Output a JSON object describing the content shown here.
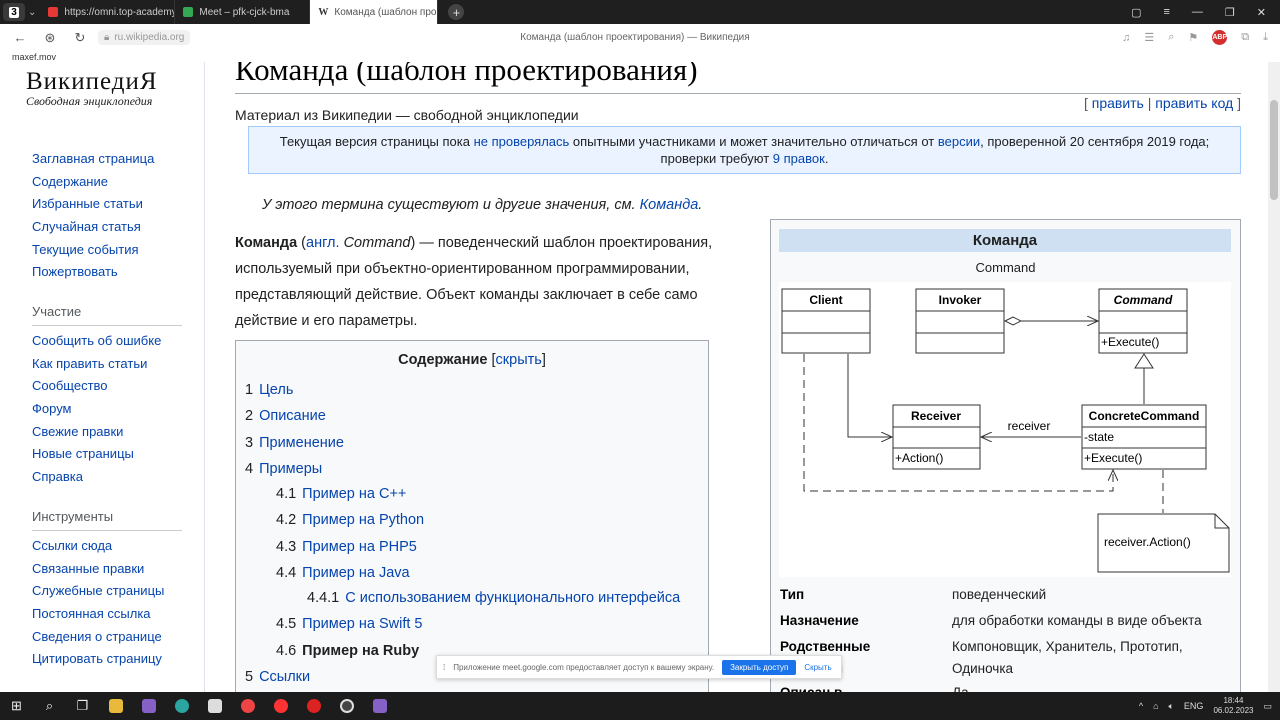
{
  "browser": {
    "tab_count": "3",
    "tabs": [
      {
        "title": "https://omni.top-academy",
        "color": "#e53935",
        "active": false
      },
      {
        "title": "Meet – pfk-cjck-bma",
        "color": "#34a853",
        "active": false
      },
      {
        "title": "Команда (шаблон про",
        "icon": "W",
        "active": true
      }
    ],
    "url": "ru.wikipedia.org",
    "page_title": "Команда (шаблон проектирования) — Википедия",
    "sublabel": "maxef.mov"
  },
  "sidebar": {
    "logo_title": "ВикипедиЯ",
    "logo_tagline": "Свободная энциклопедия",
    "main_nav": [
      "Заглавная страница",
      "Содержание",
      "Избранные статьи",
      "Случайная статья",
      "Текущие события",
      "Пожертвовать"
    ],
    "participation_head": "Участие",
    "participation": [
      "Сообщить об ошибке",
      "Как править статьи",
      "Сообщество",
      "Форум",
      "Свежие правки",
      "Новые страницы",
      "Справка"
    ],
    "tools_head": "Инструменты",
    "tools": [
      "Ссылки сюда",
      "Связанные правки",
      "Служебные страницы",
      "Постоянная ссылка",
      "Сведения о странице",
      "Цитировать страницу"
    ]
  },
  "article": {
    "title": "Команда (шаблон проектирования)",
    "edit": "править",
    "edit_code": "править код",
    "from": "Материал из Википедии — свободной энциклопедии",
    "notice_1": "Текущая версия страницы пока ",
    "notice_link1": "не проверялась",
    "notice_2": " опытными участниками и может значительно отличаться от ",
    "notice_link2": "версии",
    "notice_3": ", проверенной 20 сентября 2019 года; проверки требуют ",
    "notice_link3": "9 правок",
    "notice_4": ".",
    "hatnote_text": "У этого термина существуют и другие значения, см. ",
    "hatnote_link": "Команда",
    "lead_term": "Команда",
    "lead_lang": "англ.",
    "lead_en": "Command",
    "lead_rest": ") — поведенческий шаблон проектирования, используемый при объектно-ориентированном программировании, представляющий действие. Объект команды заключает в себе само действие и его параметры."
  },
  "toc": {
    "title": "Содержание",
    "hide": "скрыть",
    "items": [
      {
        "num": "1",
        "label": "Цель"
      },
      {
        "num": "2",
        "label": "Описание"
      },
      {
        "num": "3",
        "label": "Применение"
      },
      {
        "num": "4",
        "label": "Примеры"
      },
      {
        "num": "4.1",
        "label": "Пример на C++"
      },
      {
        "num": "4.2",
        "label": "Пример на Python"
      },
      {
        "num": "4.3",
        "label": "Пример на PHP5"
      },
      {
        "num": "4.4",
        "label": "Пример на Java"
      },
      {
        "num": "4.4.1",
        "label": "С использованием функционального интерфейса"
      },
      {
        "num": "4.5",
        "label": "Пример на Swift 5"
      },
      {
        "num": "4.6",
        "label": "Пример на Ruby"
      },
      {
        "num": "5",
        "label": "Ссылки"
      }
    ]
  },
  "infobox": {
    "title": "Команда",
    "subtitle": "Command",
    "uml": {
      "client": "Client",
      "invoker": "Invoker",
      "command": "Command",
      "command_op": "+Execute()",
      "receiver": "Receiver",
      "receiver_op": "+Action()",
      "concrete": "ConcreteCommand",
      "concrete_attr": "-state",
      "concrete_op": "+Execute()",
      "assoc": "receiver",
      "note": "receiver.Action()"
    },
    "rows": [
      {
        "key": "Тип",
        "value": "поведенческий"
      },
      {
        "key": "Назначение",
        "value": "для обработки команды в виде объекта"
      },
      {
        "key": "Родственные шаблоны",
        "value": "Компоновщик, Хранитель, Прототип, Одиночка"
      },
      {
        "key": "Описан в",
        "value": "Да"
      }
    ]
  },
  "share": {
    "text": "Приложение meet.google.com предоставляет доступ к вашему экрану.",
    "stop": "Закрыть доступ",
    "hide": "Скрыть"
  },
  "taskbar": {
    "lang": "ENG",
    "time": "18:44",
    "date": "06.02.2023"
  }
}
